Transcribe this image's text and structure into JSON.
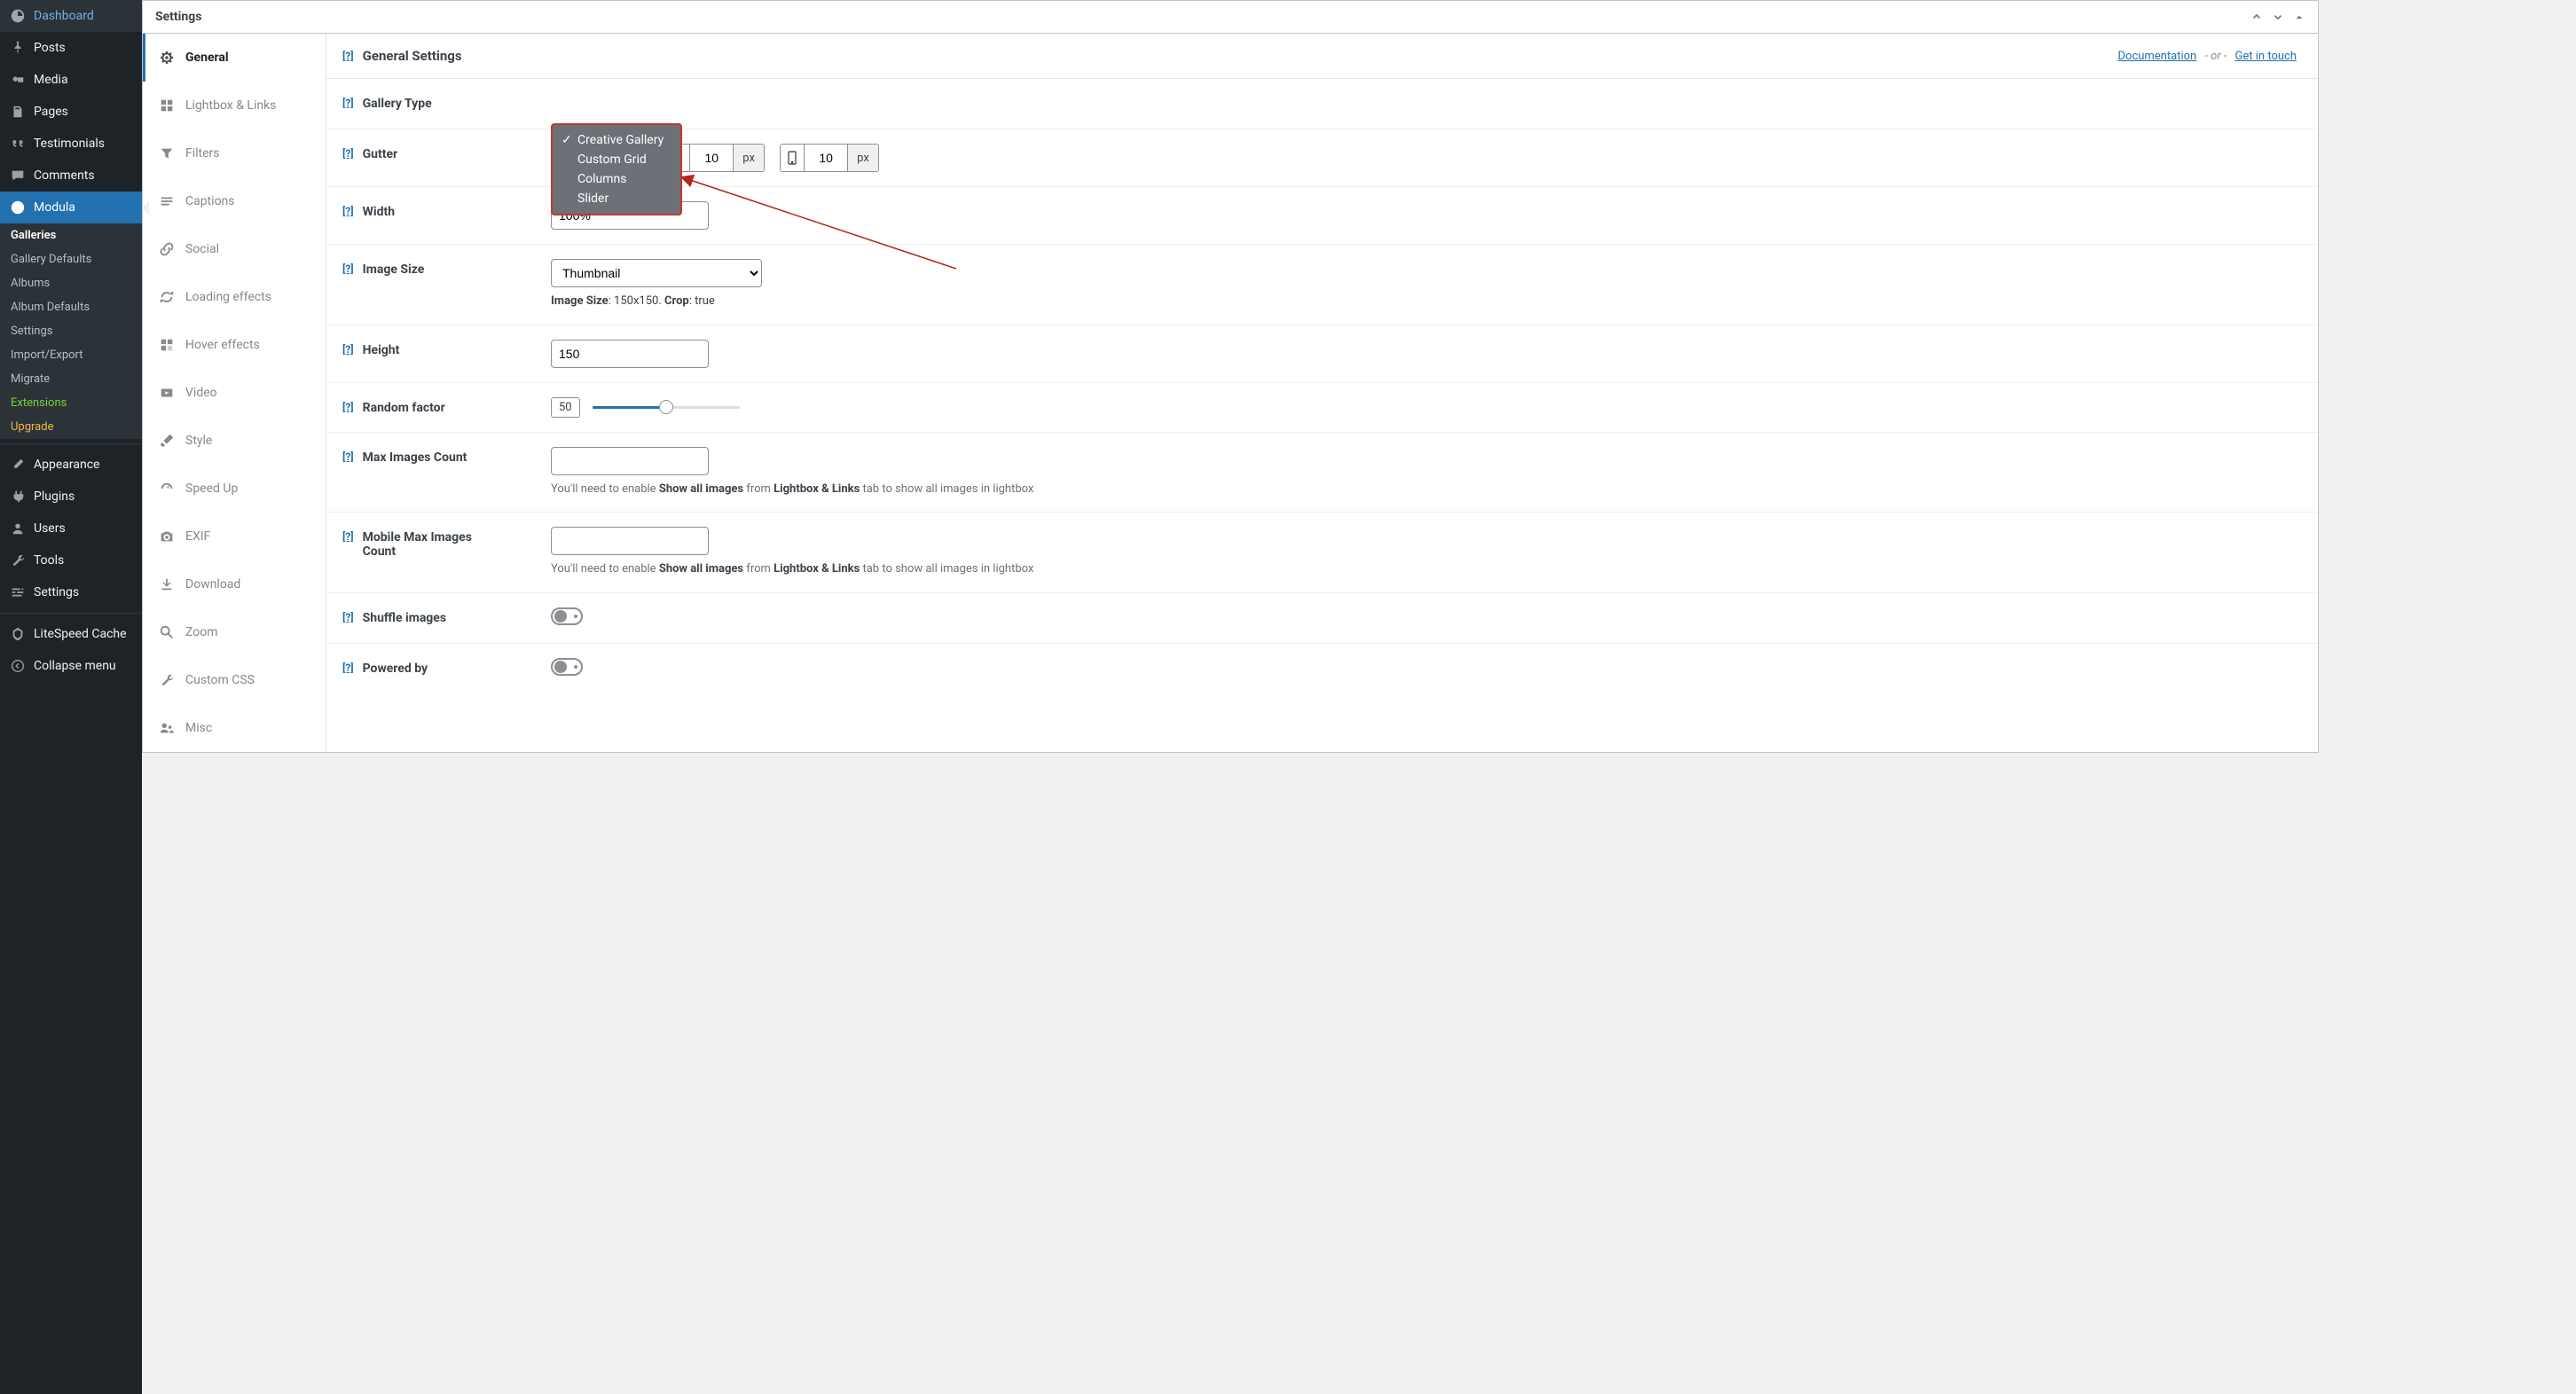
{
  "sidebar": {
    "items": [
      {
        "label": "Dashboard"
      },
      {
        "label": "Posts"
      },
      {
        "label": "Media"
      },
      {
        "label": "Pages"
      },
      {
        "label": "Testimonials"
      },
      {
        "label": "Comments"
      },
      {
        "label": "Modula"
      },
      {
        "label": "Appearance"
      },
      {
        "label": "Plugins"
      },
      {
        "label": "Users"
      },
      {
        "label": "Tools"
      },
      {
        "label": "Settings"
      },
      {
        "label": "LiteSpeed Cache"
      },
      {
        "label": "Collapse menu"
      }
    ],
    "submenu": [
      {
        "label": "Galleries",
        "current": true
      },
      {
        "label": "Gallery Defaults"
      },
      {
        "label": "Albums"
      },
      {
        "label": "Album Defaults"
      },
      {
        "label": "Settings"
      },
      {
        "label": "Import/Export"
      },
      {
        "label": "Migrate"
      },
      {
        "label": "Extensions",
        "class": "green"
      },
      {
        "label": "Upgrade",
        "class": "gold"
      }
    ]
  },
  "panel": {
    "title": "Settings"
  },
  "tabs": [
    {
      "label": "General",
      "active": true
    },
    {
      "label": "Lightbox & Links"
    },
    {
      "label": "Filters"
    },
    {
      "label": "Captions"
    },
    {
      "label": "Social"
    },
    {
      "label": "Loading effects"
    },
    {
      "label": "Hover effects"
    },
    {
      "label": "Video"
    },
    {
      "label": "Style"
    },
    {
      "label": "Speed Up"
    },
    {
      "label": "EXIF"
    },
    {
      "label": "Download"
    },
    {
      "label": "Zoom"
    },
    {
      "label": "Custom CSS"
    },
    {
      "label": "Misc"
    }
  ],
  "content_header": {
    "title": "General Settings",
    "doc_link": "Documentation",
    "sep": "- or -",
    "contact_link": "Get in touch"
  },
  "help_badge": "[?]",
  "fields": {
    "gallery_type": {
      "label": "Gallery Type",
      "options": [
        "Creative Gallery",
        "Custom Grid",
        "Columns",
        "Slider"
      ],
      "selected": "Creative Gallery"
    },
    "gutter": {
      "label": "Gutter",
      "tablet": {
        "value": "10",
        "unit": "px"
      },
      "mobile": {
        "value": "10",
        "unit": "px"
      }
    },
    "width": {
      "label": "Width",
      "value": "100%"
    },
    "image_size": {
      "label": "Image Size",
      "selected": "Thumbnail",
      "desc_label": "Image Size",
      "desc_value": ": 150x150. ",
      "desc_crop_label": "Crop",
      "desc_crop_value": ": true"
    },
    "height": {
      "label": "Height",
      "value": "150"
    },
    "random_factor": {
      "label": "Random factor",
      "value": "50",
      "percent": 50
    },
    "max_images": {
      "label": "Max Images Count",
      "value": "",
      "desc_pre": "You'll need to enable ",
      "desc_bold1": "Show all images",
      "desc_mid": " from ",
      "desc_bold2": "Lightbox & Links",
      "desc_post": " tab to show all images in lightbox"
    },
    "mobile_max_images": {
      "label": "Mobile Max Images Count",
      "value": ""
    },
    "shuffle": {
      "label": "Shuffle images"
    },
    "powered": {
      "label": "Powered by"
    }
  }
}
